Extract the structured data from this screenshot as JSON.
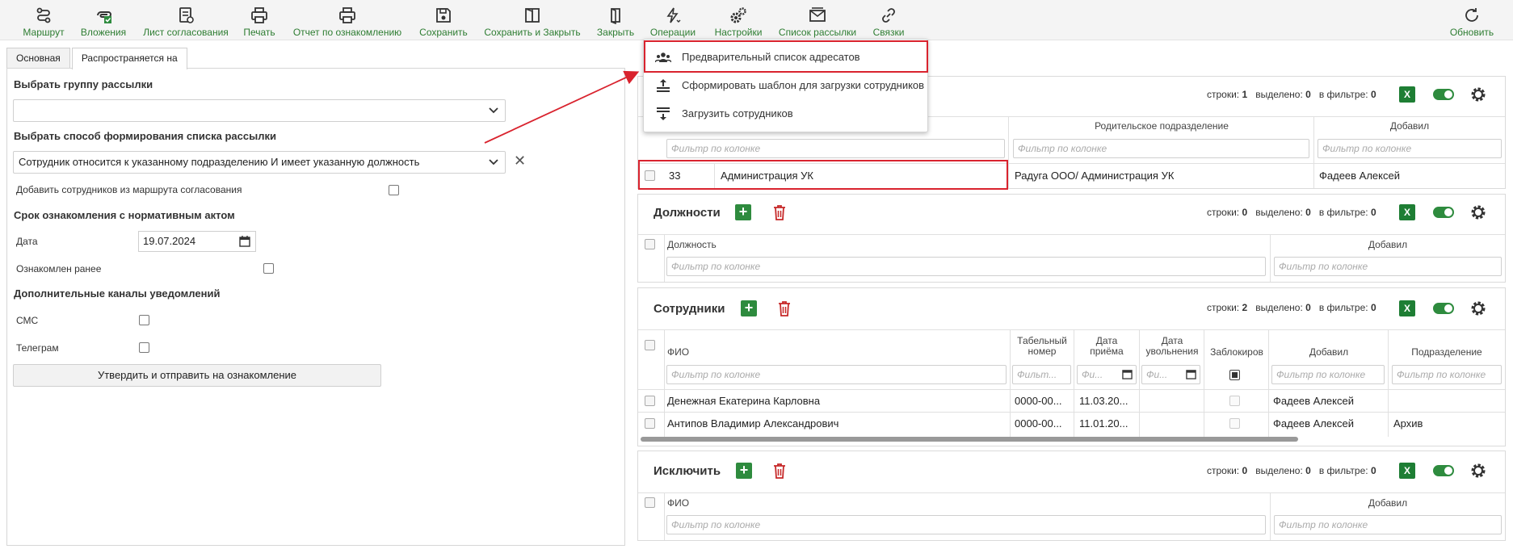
{
  "toolbar": {
    "items": [
      {
        "label": "Маршрут",
        "icon": "route-icon"
      },
      {
        "label": "Вложения",
        "icon": "attachment-icon"
      },
      {
        "label": "Лист согласования",
        "icon": "approval-sheet-icon"
      },
      {
        "label": "Печать",
        "icon": "print-icon"
      },
      {
        "label": "Отчет по ознакомлению",
        "icon": "print-report-icon"
      },
      {
        "label": "Сохранить",
        "icon": "save-icon"
      },
      {
        "label": "Сохранить и Закрыть",
        "icon": "save-close-icon"
      },
      {
        "label": "Закрыть",
        "icon": "close-doc-icon"
      },
      {
        "label": "Операции",
        "icon": "operations-icon"
      },
      {
        "label": "Настройки",
        "icon": "settings-icon"
      },
      {
        "label": "Список рассылки",
        "icon": "mailing-list-icon"
      },
      {
        "label": "Связки",
        "icon": "links-icon"
      }
    ],
    "refresh_label": "Обновить"
  },
  "tabs": [
    "Основная",
    "Распространяется на"
  ],
  "form": {
    "group_label": "Выбрать группу рассылки",
    "group_value": "",
    "method_label": "Выбрать способ формирования списка рассылки",
    "method_value": "Сотрудник относится к указанному подразделению И имеет указанную должность",
    "add_from_route_label": "Добавить сотрудников из маршрута согласования",
    "deadline_title": "Срок ознакомления с нормативным актом",
    "date_label": "Дата",
    "date_value": "19.07.2024",
    "acquainted_label": "Ознакомлен ранее",
    "channels_title": "Дополнительные каналы уведомлений",
    "sms_label": "СМС",
    "telegram_label": "Телеграм",
    "submit_label": "Утвердить и отправить на ознакомление"
  },
  "menu": {
    "items": [
      {
        "label": "Предварительный список адресатов",
        "icon": "recipients-icon"
      },
      {
        "label": "Сформировать шаблон для загрузки сотрудников",
        "icon": "template-upload-icon"
      },
      {
        "label": "Загрузить сотрудников",
        "icon": "download-list-icon"
      }
    ]
  },
  "common": {
    "filter_placeholder": "Фильтр по колонке",
    "filter_short": "Фильт...",
    "filter_tiny": "Фи...",
    "rows_label": "строки:",
    "selected_label": "выделено:",
    "in_filter_label": "в фильтре:",
    "excel": "X"
  },
  "departments": {
    "rows": "1",
    "selected": "0",
    "in_filter": "0",
    "col_parent": "Родительское подразделение",
    "col_added": "Добавил",
    "row": {
      "code": "33",
      "name": "Администрация УК",
      "parent": "Радуга ООО/ Администрация УК",
      "added": "Фадеев Алексей"
    }
  },
  "positions": {
    "title": "Должности",
    "rows": "0",
    "selected": "0",
    "in_filter": "0",
    "col_position": "Должность",
    "col_added": "Добавил"
  },
  "employees": {
    "title": "Сотрудники",
    "rows": "2",
    "selected": "0",
    "in_filter": "0",
    "col_fio": "ФИО",
    "col_tab_1": "Табельный",
    "col_tab_2": "номер",
    "col_hire_1": "Дата",
    "col_hire_2": "приёма",
    "col_fire_1": "Дата",
    "col_fire_2": "увольнения",
    "col_blocked": "Заблокиров",
    "col_added": "Добавил",
    "col_dept": "Подразделение",
    "rows_data": [
      {
        "fio": "Денежная Екатерина Карловна",
        "tab": "0000-00...",
        "hire": "11.03.20...",
        "fire": "",
        "added": "Фадеев Алексей",
        "dept": ""
      },
      {
        "fio": "Антипов Владимир Александрович",
        "tab": "0000-00...",
        "hire": "11.01.20...",
        "fire": "",
        "added": "Фадеев Алексей",
        "dept": "Архив"
      }
    ]
  },
  "exclude": {
    "title": "Исключить",
    "rows": "0",
    "selected": "0",
    "in_filter": "0",
    "col_fio": "ФИО",
    "col_added": "Добавил"
  },
  "colors": {
    "accent_green": "#2e8b3e",
    "toolbar_text": "#2e7d32",
    "highlight_red": "#d9232e",
    "delete_red": "#c62828"
  }
}
